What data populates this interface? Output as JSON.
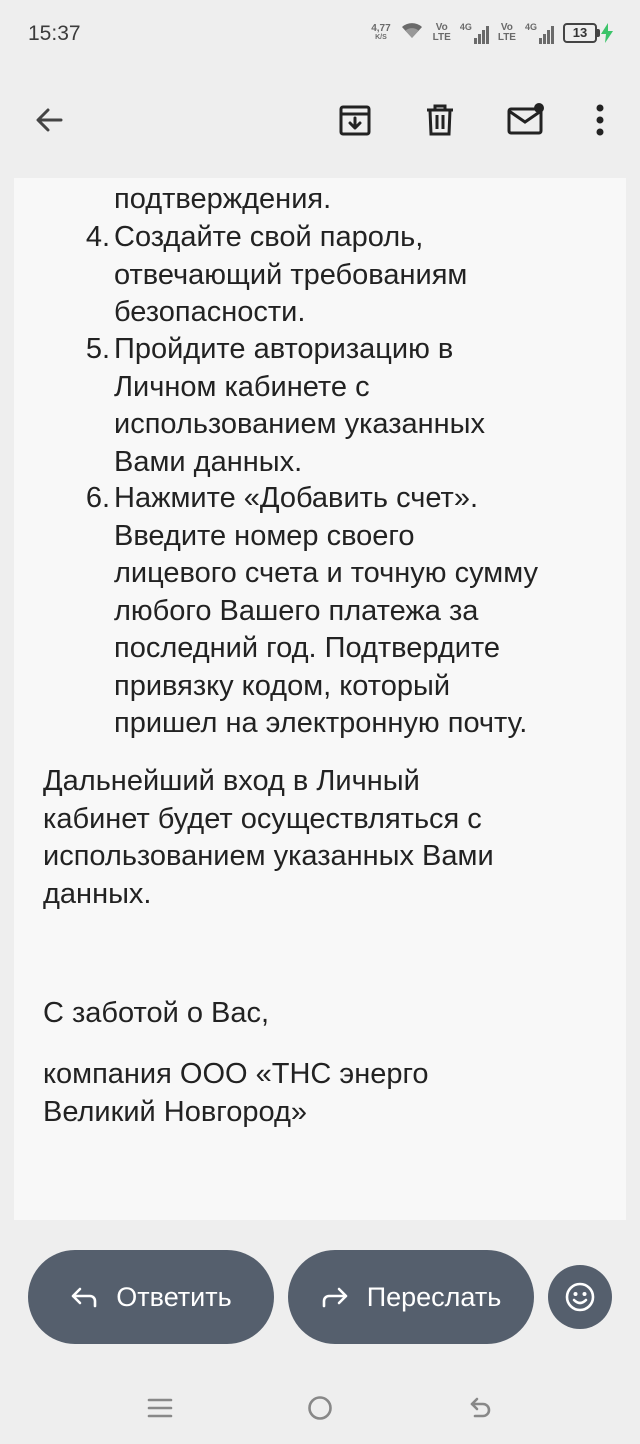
{
  "status_bar": {
    "time": "15:37",
    "net_speed": "4,77",
    "net_speed_unit": "K/S",
    "sim1_volte": "Vo",
    "sim1_lte": "LTE",
    "sim1_network": "4G",
    "sim2_volte": "Vo",
    "sim2_lte": "LTE",
    "sim2_network": "4G",
    "battery_level": "13"
  },
  "toolbar": {
    "icons": [
      "back-arrow-icon",
      "archive-icon",
      "delete-icon",
      "mark-unread-icon",
      "more-vertical-icon"
    ]
  },
  "email": {
    "partial_top_line": "подтверждения.",
    "steps": [
      {
        "number": "4.",
        "lines": [
          "Создайте свой пароль,",
          "отвечающий требованиям",
          "безопасности."
        ]
      },
      {
        "number": "5.",
        "lines": [
          "Пройдите авторизацию в",
          "Личном кабинете с",
          "использованием указанных",
          "Вами данных."
        ]
      },
      {
        "number": "6.",
        "lines": [
          "Нажмите «Добавить счет».",
          "Введите номер своего",
          "лицевого счета и точную сумму",
          "любого Вашего платежа за",
          "последний год. Подтвердите",
          "привязку кодом, который",
          "пришел на электронную почту."
        ]
      }
    ],
    "paragraph_lines": [
      "Дальнейший вход в Личный",
      "кабинет будет осуществляться с",
      "использованием указанных Вами",
      "данных."
    ],
    "closing": "С заботой о Вас,",
    "signature_lines": [
      "компания ООО «ТНС энерго",
      "Великий Новгород»"
    ]
  },
  "actions": {
    "reply_label": "Ответить",
    "forward_label": "Переслать"
  },
  "colors": {
    "action_button": "#555f6d",
    "background": "#eeeeee",
    "content_background": "#f8f8f8"
  }
}
